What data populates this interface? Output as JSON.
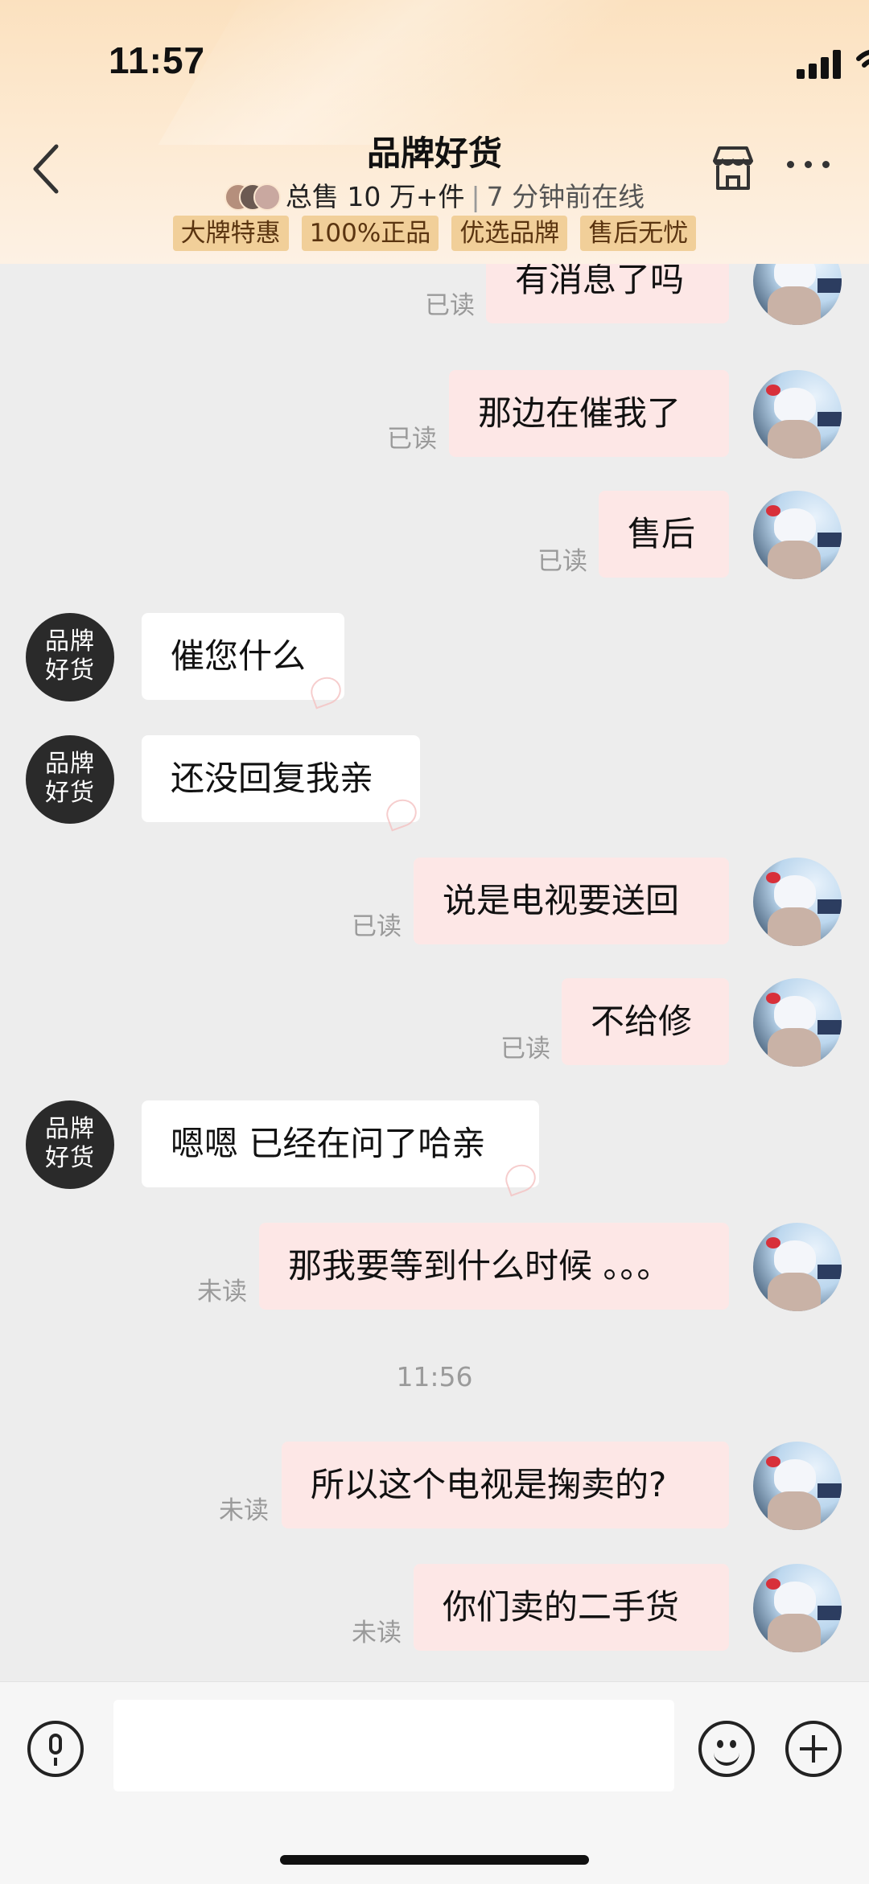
{
  "status_bar": {
    "time": "11:57",
    "icons": [
      "signal-icon",
      "wifi-icon",
      "battery-icon"
    ]
  },
  "header": {
    "title": "品牌好货",
    "sales": "总售 10 万+件",
    "online": "7 分钟前在线",
    "tags": [
      "大牌特惠",
      "100%正品",
      "优选品牌",
      "售后无忧"
    ],
    "icons": [
      "back-icon",
      "store-icon",
      "more-icon"
    ]
  },
  "shop_avatar_text": [
    "品牌",
    "好货"
  ],
  "messages": [
    {
      "dir": "out",
      "text": "有消息了吗",
      "status": "已读"
    },
    {
      "dir": "out",
      "text": "那边在催我了",
      "status": "已读"
    },
    {
      "dir": "out",
      "text": "售后",
      "status": "已读"
    },
    {
      "dir": "in",
      "text": "催您什么"
    },
    {
      "dir": "in",
      "text": "还没回复我亲"
    },
    {
      "dir": "out",
      "text": "说是电视要送回",
      "status": "已读"
    },
    {
      "dir": "out",
      "text": "不给修",
      "status": "已读"
    },
    {
      "dir": "in",
      "text": "嗯嗯 已经在问了哈亲"
    },
    {
      "dir": "out",
      "text": "那我要等到什么时候 。。。",
      "status": "未读"
    },
    {
      "dir": "out",
      "text": "所以这个电视是掬卖的?",
      "status": "未读"
    },
    {
      "dir": "out",
      "text": "你们卖的二手货",
      "status": "未读"
    }
  ],
  "timestamp": "11:56",
  "input": {
    "value": "",
    "icons": [
      "microphone-icon",
      "emoji-icon",
      "plus-icon"
    ]
  },
  "colors": {
    "header_bg": "#fbe1bf",
    "tag_bg": "#f1cf99",
    "bubble_out": "#fde7e6",
    "bubble_in": "#ffffff",
    "chat_bg": "#ededed"
  }
}
